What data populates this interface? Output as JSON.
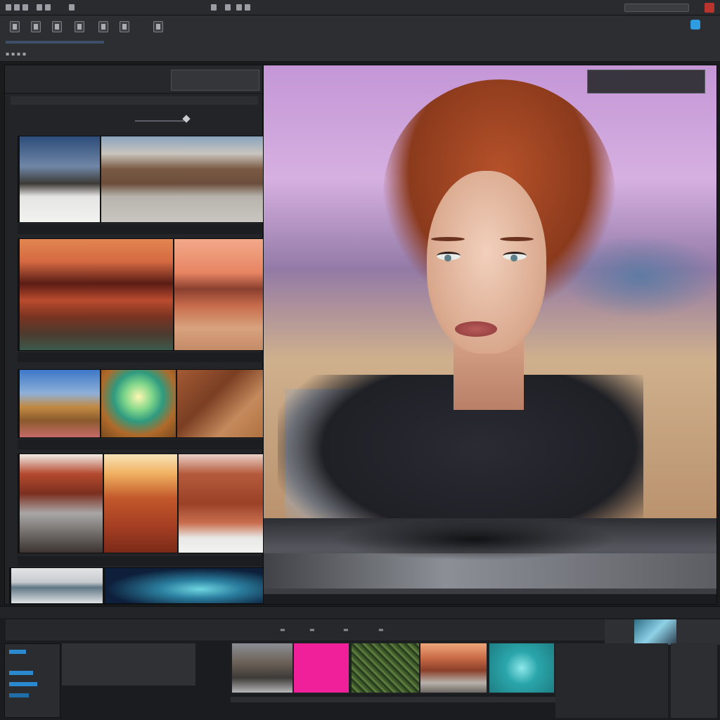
{
  "menubar": {
    "items": [
      "",
      "",
      "",
      "",
      "",
      ""
    ]
  },
  "toolbar": {
    "tools": [
      "",
      "",
      "",
      "",
      "",
      "",
      ""
    ]
  },
  "left_panel": {
    "title": "",
    "rows": [
      {
        "thumbs": [
          "mountain-snow",
          "volcanic-crater"
        ]
      },
      {
        "thumbs": [
          "red-rocks-sunset",
          "desert-dusk"
        ]
      },
      {
        "thumbs": [
          "blue-sky-hills",
          "green-sunrise",
          "brown-slope"
        ]
      },
      {
        "thumbs": [
          "red-hill",
          "orange-sunset",
          "canyon-wall"
        ]
      },
      {
        "thumbs": [
          "lake-horizon",
          "blue-glow"
        ]
      }
    ]
  },
  "preview": {
    "subject": "portrait-woman-red-hair"
  },
  "bottom": {
    "tabs": [
      "",
      "",
      "",
      ""
    ],
    "tiles": [
      "rocky-landscape",
      "magenta-swatch",
      "green-texture",
      "rock-sunset",
      "teal-swatch"
    ]
  },
  "colors": {
    "accent_blue": "#2f9be0",
    "window_close": "#b9342c",
    "magenta_tile": "#f01f9a",
    "teal_tile": "#2aa6ab"
  }
}
